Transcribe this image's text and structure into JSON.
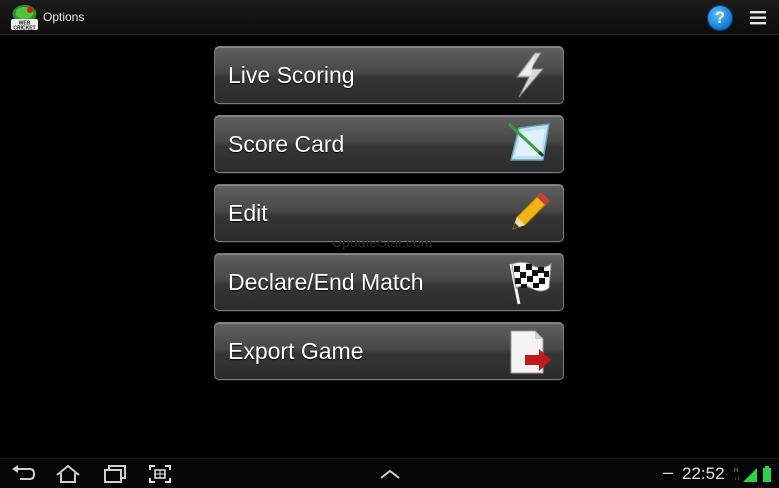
{
  "app": {
    "title": "Options",
    "logo_text": "WEB CRICKET"
  },
  "actionbar": {
    "help_label": "?",
    "help_icon": "help-icon",
    "overflow_icon": "overflow-menu-icon",
    "help_color": "#1a86e0"
  },
  "menu": {
    "items": [
      {
        "label": "Live Scoring",
        "icon": "lightning-icon"
      },
      {
        "label": "Score Card",
        "icon": "scorecard-icon"
      },
      {
        "label": "Edit",
        "icon": "pencil-icon"
      },
      {
        "label": "Declare/End Match",
        "icon": "checkered-flag-icon"
      },
      {
        "label": "Export Game",
        "icon": "export-document-icon"
      }
    ]
  },
  "watermark": "UpdateStar.com",
  "systembar": {
    "clock": "22:52",
    "minus": "–",
    "buttons": [
      "back-icon",
      "home-icon",
      "recent-apps-icon",
      "screenshot-icon",
      "up-chevron-icon"
    ],
    "accent": "#2ad44a"
  }
}
